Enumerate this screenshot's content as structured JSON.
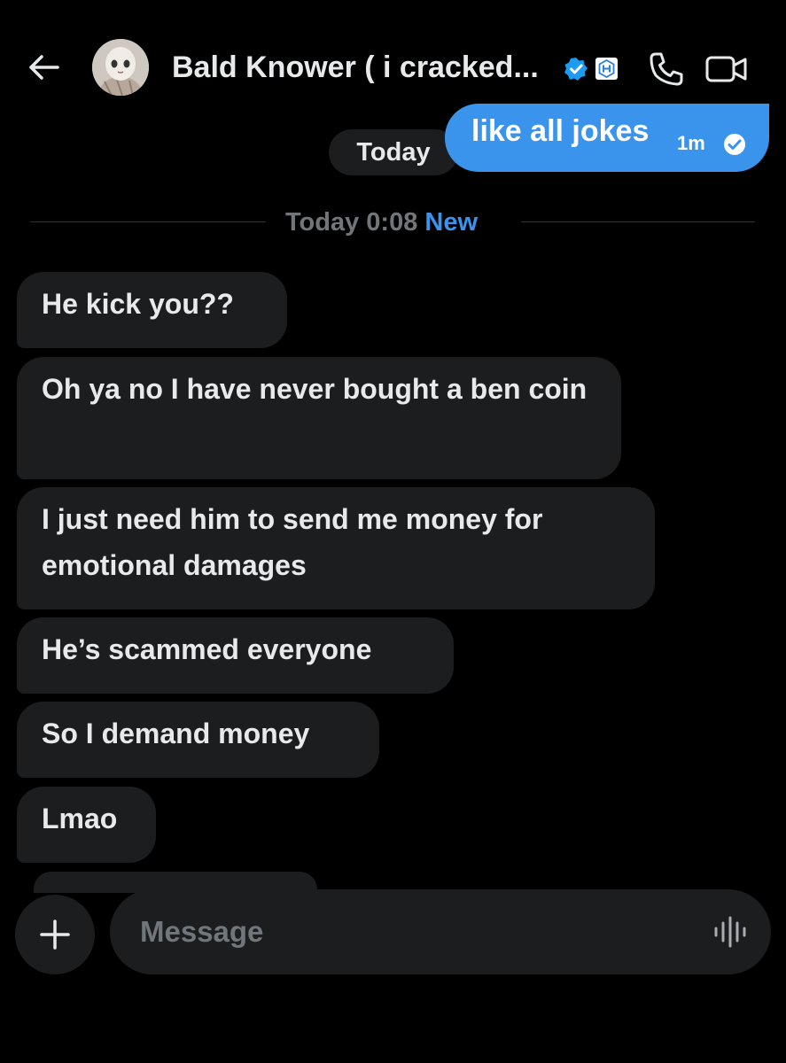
{
  "header": {
    "title": "Bald Knower ( i cracked...",
    "icons": [
      "back-arrow-icon",
      "verified-badge-icon",
      "affiliate-badge-icon",
      "phone-icon",
      "video-camera-icon"
    ]
  },
  "conversation": {
    "date_pill": "Today",
    "sent_message": {
      "text": "like all jokes",
      "time": "1m"
    },
    "divider": {
      "timestamp": "Today 0:08",
      "new_label": "New"
    },
    "received_messages": [
      {
        "text": "He kick you??"
      },
      {
        "text": "Oh ya no I have never bought a ben coin"
      },
      {
        "text": "I just need him to send me money for emotional damages"
      },
      {
        "text": "He’s scammed everyone"
      },
      {
        "text": "So I demand money"
      },
      {
        "text": "Lmao"
      }
    ]
  },
  "composer": {
    "placeholder": "Message",
    "icons": [
      "plus-icon",
      "voice-wave-icon"
    ]
  },
  "colors": {
    "background": "#000000",
    "bubble_received": "#1c1d1f",
    "bubble_sent": "#3a94ec",
    "muted_text": "#71767b",
    "accent": "#3a94ec"
  }
}
